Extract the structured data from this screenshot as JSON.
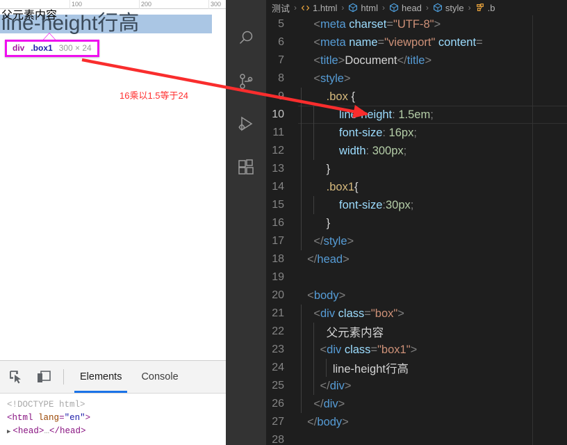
{
  "browser": {
    "ruler": {
      "ticks": [
        "100",
        "200",
        "300"
      ]
    },
    "page": {
      "parent_text": "父元素内容",
      "child_text": "line-height行高"
    },
    "inspector_badge": {
      "tag": "div",
      "class": ".box1",
      "dimensions": "300 × 24",
      "border_color": "#ef0fef"
    },
    "annotation": {
      "text": "16乘以1.5等于24",
      "color": "#ff2f2f"
    },
    "highlight_color": "#aac6e4"
  },
  "devtools": {
    "icons": [
      {
        "name": "inspect-element-icon"
      },
      {
        "name": "device-toolbar-icon"
      }
    ],
    "tabs": [
      {
        "label": "Elements",
        "active": true
      },
      {
        "label": "Console",
        "active": false
      }
    ],
    "dom_tree": [
      {
        "kind": "doctype",
        "text": "<!DOCTYPE html>"
      },
      {
        "kind": "element",
        "open": "<",
        "tag": "html",
        "attr": "lang",
        "eq": "=",
        "val": "\"en\"",
        "close": ">"
      },
      {
        "kind": "collapsed",
        "arrow": "▶",
        "text_open": "<head>",
        "ellipsis": "…",
        "text_close": "</head>"
      }
    ]
  },
  "vscode": {
    "activity_bar": [
      {
        "name": "search-icon"
      },
      {
        "name": "source-control-icon"
      },
      {
        "name": "run-and-debug-icon"
      },
      {
        "name": "extensions-icon"
      }
    ],
    "breadcrumb": [
      {
        "label": "测试",
        "icon": "folder"
      },
      {
        "label": "1.html",
        "icon": "html-file"
      },
      {
        "label": "html",
        "icon": "symbol-cube"
      },
      {
        "label": "head",
        "icon": "symbol-cube"
      },
      {
        "label": "style",
        "icon": "symbol-cube"
      },
      {
        "label": ".b",
        "icon": "symbol-ruler"
      }
    ],
    "highlight_color": "#ef0fef",
    "current_line": 10,
    "lines": [
      {
        "n": "5",
        "indent": 0,
        "guides": 0,
        "tokens": [
          {
            "c": "t-punct",
            "t": "    <"
          },
          {
            "c": "t-tag",
            "t": "meta"
          },
          {
            "c": "t-attr",
            "t": " charset"
          },
          {
            "c": "t-punct",
            "t": "="
          },
          {
            "c": "t-str",
            "t": "\"UTF-8\""
          },
          {
            "c": "t-punct",
            "t": ">"
          }
        ]
      },
      {
        "n": "6",
        "indent": 0,
        "guides": 0,
        "tokens": [
          {
            "c": "t-punct",
            "t": "    <"
          },
          {
            "c": "t-tag",
            "t": "meta"
          },
          {
            "c": "t-attr",
            "t": " name"
          },
          {
            "c": "t-punct",
            "t": "="
          },
          {
            "c": "t-str",
            "t": "\"viewport\""
          },
          {
            "c": "t-attr",
            "t": " content"
          },
          {
            "c": "t-punct",
            "t": "="
          }
        ]
      },
      {
        "n": "7",
        "indent": 0,
        "guides": 0,
        "tokens": [
          {
            "c": "t-punct",
            "t": "    <"
          },
          {
            "c": "t-tag",
            "t": "title"
          },
          {
            "c": "t-punct",
            "t": ">"
          },
          {
            "c": "t-text",
            "t": "Document"
          },
          {
            "c": "t-punct",
            "t": "</"
          },
          {
            "c": "t-tag",
            "t": "title"
          },
          {
            "c": "t-punct",
            "t": ">"
          }
        ]
      },
      {
        "n": "8",
        "indent": 0,
        "guides": 0,
        "tokens": [
          {
            "c": "t-punct",
            "t": "    <"
          },
          {
            "c": "t-tag",
            "t": "style"
          },
          {
            "c": "t-punct",
            "t": ">"
          }
        ]
      },
      {
        "n": "9",
        "indent": 0,
        "guides": 1,
        "tokens": [
          {
            "c": "t-sel",
            "t": "        .box "
          },
          {
            "c": "t-brace",
            "t": "{"
          }
        ]
      },
      {
        "n": "10",
        "indent": 0,
        "guides": 2,
        "current": true,
        "tokens": [
          {
            "c": "t-prop",
            "t": "            line-height"
          },
          {
            "c": "t-punct",
            "t": ": "
          },
          {
            "c": "t-num",
            "t": "1.5em"
          },
          {
            "c": "t-punct",
            "t": ";"
          }
        ]
      },
      {
        "n": "11",
        "indent": 0,
        "guides": 2,
        "tokens": [
          {
            "c": "t-prop",
            "t": "            font-size"
          },
          {
            "c": "t-punct",
            "t": ": "
          },
          {
            "c": "t-num",
            "t": "16px"
          },
          {
            "c": "t-punct",
            "t": ";"
          }
        ]
      },
      {
        "n": "12",
        "indent": 0,
        "guides": 2,
        "tokens": [
          {
            "c": "t-prop",
            "t": "            width"
          },
          {
            "c": "t-punct",
            "t": ": "
          },
          {
            "c": "t-num",
            "t": "300px"
          },
          {
            "c": "t-punct",
            "t": ";"
          }
        ]
      },
      {
        "n": "13",
        "indent": 0,
        "guides": 1,
        "tokens": [
          {
            "c": "t-brace",
            "t": "        }"
          }
        ]
      },
      {
        "n": "14",
        "indent": 0,
        "guides": 1,
        "tokens": [
          {
            "c": "t-sel",
            "t": "        .box1"
          },
          {
            "c": "t-brace",
            "t": "{"
          }
        ]
      },
      {
        "n": "15",
        "indent": 0,
        "guides": 2,
        "tokens": [
          {
            "c": "t-prop",
            "t": "            font-size"
          },
          {
            "c": "t-punct",
            "t": ":"
          },
          {
            "c": "t-num",
            "t": "30px"
          },
          {
            "c": "t-punct",
            "t": ";"
          }
        ]
      },
      {
        "n": "16",
        "indent": 0,
        "guides": 1,
        "tokens": [
          {
            "c": "t-brace",
            "t": "        }"
          }
        ]
      },
      {
        "n": "17",
        "indent": 0,
        "guides": 1,
        "tokens": [
          {
            "c": "t-punct",
            "t": "    </"
          },
          {
            "c": "t-tag",
            "t": "style"
          },
          {
            "c": "t-punct",
            "t": ">"
          }
        ]
      },
      {
        "n": "18",
        "indent": 0,
        "guides": 0,
        "tokens": [
          {
            "c": "t-punct",
            "t": "  </"
          },
          {
            "c": "t-tag",
            "t": "head"
          },
          {
            "c": "t-punct",
            "t": ">"
          }
        ]
      },
      {
        "n": "19",
        "indent": 0,
        "guides": 0,
        "tokens": []
      },
      {
        "n": "20",
        "indent": 0,
        "guides": 0,
        "tokens": [
          {
            "c": "t-punct",
            "t": "  <"
          },
          {
            "c": "t-tag",
            "t": "body"
          },
          {
            "c": "t-punct",
            "t": ">"
          }
        ]
      },
      {
        "n": "21",
        "indent": 0,
        "guides": 1,
        "tokens": [
          {
            "c": "t-punct",
            "t": "    <"
          },
          {
            "c": "t-tag",
            "t": "div"
          },
          {
            "c": "t-attr",
            "t": " class"
          },
          {
            "c": "t-punct",
            "t": "="
          },
          {
            "c": "t-str",
            "t": "\"box\""
          },
          {
            "c": "t-punct",
            "t": ">"
          }
        ]
      },
      {
        "n": "22",
        "indent": 0,
        "guides": 2,
        "tokens": [
          {
            "c": "t-text",
            "t": "        父元素内容"
          }
        ]
      },
      {
        "n": "23",
        "indent": 0,
        "guides": 2,
        "tokens": [
          {
            "c": "t-punct",
            "t": "      <"
          },
          {
            "c": "t-tag",
            "t": "div"
          },
          {
            "c": "t-attr",
            "t": " class"
          },
          {
            "c": "t-punct",
            "t": "="
          },
          {
            "c": "t-str",
            "t": "\"box1\""
          },
          {
            "c": "t-punct",
            "t": ">"
          }
        ]
      },
      {
        "n": "24",
        "indent": 0,
        "guides": 3,
        "tokens": [
          {
            "c": "t-text",
            "t": "          line-height行高"
          }
        ]
      },
      {
        "n": "25",
        "indent": 0,
        "guides": 2,
        "tokens": [
          {
            "c": "t-punct",
            "t": "      </"
          },
          {
            "c": "t-tag",
            "t": "div"
          },
          {
            "c": "t-punct",
            "t": ">"
          }
        ]
      },
      {
        "n": "26",
        "indent": 0,
        "guides": 1,
        "tokens": [
          {
            "c": "t-punct",
            "t": "    </"
          },
          {
            "c": "t-tag",
            "t": "div"
          },
          {
            "c": "t-punct",
            "t": ">"
          }
        ]
      },
      {
        "n": "27",
        "indent": 0,
        "guides": 0,
        "tokens": [
          {
            "c": "t-punct",
            "t": "  </"
          },
          {
            "c": "t-tag",
            "t": "body"
          },
          {
            "c": "t-punct",
            "t": ">"
          }
        ]
      },
      {
        "n": "28",
        "indent": 0,
        "guides": 0,
        "tokens": []
      }
    ]
  }
}
